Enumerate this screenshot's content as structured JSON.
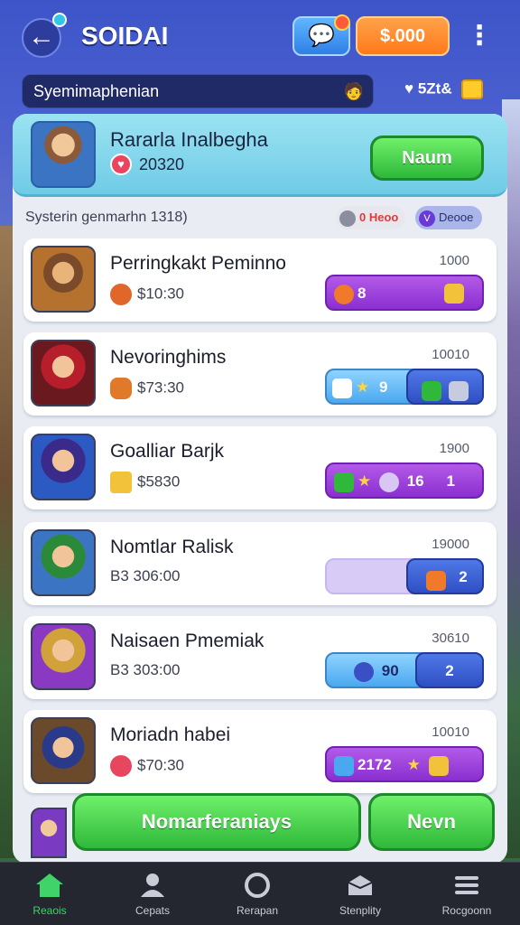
{
  "header": {
    "title": "SOIDAI",
    "coins": "$.000"
  },
  "strip": {
    "text": "Syemimaphenian",
    "extra": "5Zt&"
  },
  "featured": {
    "name": "Rararla Inalbegha",
    "score": "20320",
    "button": "Naum"
  },
  "section": {
    "title": "Systerin genmarhn 1318)",
    "badge1": "0 Heoo",
    "badge2": "Deooe"
  },
  "rows": [
    {
      "name": "Perringkakt Peminno",
      "value": "$10:30",
      "count": "1000",
      "pill_text": "8",
      "pill_right": ""
    },
    {
      "name": "Nevoringhims",
      "value": "$73:30",
      "count": "10010",
      "pill_text": "9",
      "pill_right": ""
    },
    {
      "name": "Goalliar Barjk",
      "value": "$5830",
      "count": "1900",
      "pill_text": "16",
      "pill_right": "1"
    },
    {
      "name": "Nomtlar Ralisk",
      "value": "B3 306:00",
      "count": "19000",
      "pill_text": "",
      "pill_right": "2"
    },
    {
      "name": "Naisaen Pmemiak",
      "value": "B3 303:00",
      "count": "30610",
      "pill_text": "90",
      "pill_right": "2"
    },
    {
      "name": "Moriadn habei",
      "value": "$70:30",
      "count": "10010",
      "pill_text": "2172",
      "pill_right": ""
    }
  ],
  "actions": {
    "main": "Nomarferaniays",
    "side": "Nevn"
  },
  "nav": [
    {
      "label": "Reaois",
      "icon": "home-icon"
    },
    {
      "label": "Cepats",
      "icon": "person-icon"
    },
    {
      "label": "Rerapan",
      "icon": "ring-icon"
    },
    {
      "label": "Stenplity",
      "icon": "box-icon"
    },
    {
      "label": "Rocgoonn",
      "icon": "menu-icon"
    }
  ],
  "colors": {
    "accent_green": "#2fb83a",
    "accent_purple": "#8a2fd0",
    "accent_blue": "#4aa8ef",
    "header_blue": "#3d55c9"
  }
}
